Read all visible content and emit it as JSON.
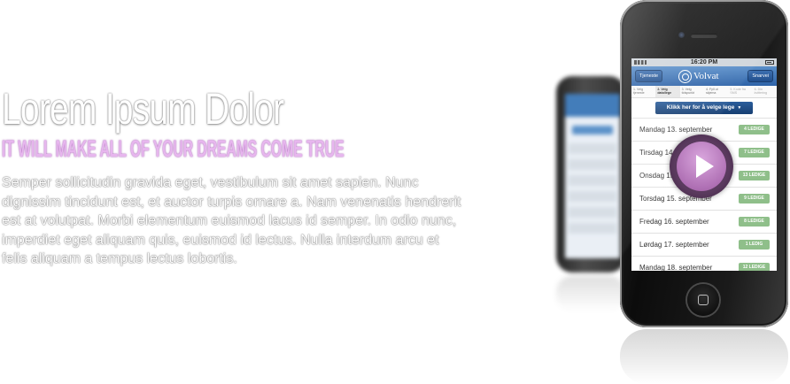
{
  "hero": {
    "title": "Lorem Ipsum Dolor",
    "subtitle": "IT WILL MAKE ALL OF YOUR DREAMS COME TRUE",
    "body": "Semper sollicitudin gravida eget, vestibulum sit amet sapien. Nunc dignissim tincidunt est, et auctor turpis ornare a. Nam venenatis hendrerit est at volutpat. Morbi elementum euismod lacus id semper. In odio nunc, imperdiet eget aliquam quis, euismod id lectus. Nulla interdum arcu et felis aliquam a tempus lectus lobortis."
  },
  "phone": {
    "status_time": "16:20 PM",
    "nav": {
      "left_button": "Tjeneste",
      "logo_text": "Volvat",
      "right_button": "Snarvei"
    },
    "steps": [
      {
        "label": "1. Velg tjeneste"
      },
      {
        "label": "2. Velg dato/lege"
      },
      {
        "label": "3. Velg tidspunkt"
      },
      {
        "label": "4. Fyll ut skjema"
      },
      {
        "label": "5. Kode fra SMS"
      },
      {
        "label": "6. Din kvittering"
      }
    ],
    "select_button": "Klikk her for å velge lege",
    "dates": [
      {
        "label": "Mandag 13. september",
        "badge": "4 LEDIGE"
      },
      {
        "label": "Tirsdag 14. september",
        "badge": "7 LEDIGE"
      },
      {
        "label": "Onsdag 15. september",
        "badge": "13 LEDIGE"
      },
      {
        "label": "Torsdag 15. september",
        "badge": "9 LEDIGE"
      },
      {
        "label": "Fredag 16. september",
        "badge": "8 LEDIGE"
      },
      {
        "label": "Lørdag 17. september",
        "badge": "1 LEDIG"
      },
      {
        "label": "Mandag 18. september",
        "badge": "12 LEDIGE"
      }
    ]
  },
  "colors": {
    "subtitle": "#e7b6ee",
    "nav_blue": "#2e63a8",
    "badge_green": "#8fbf8a",
    "play_purple": "#b071b5"
  },
  "icons": {
    "play": "play-icon",
    "home": "home-button-icon",
    "logo": "volvat-logo-icon"
  }
}
